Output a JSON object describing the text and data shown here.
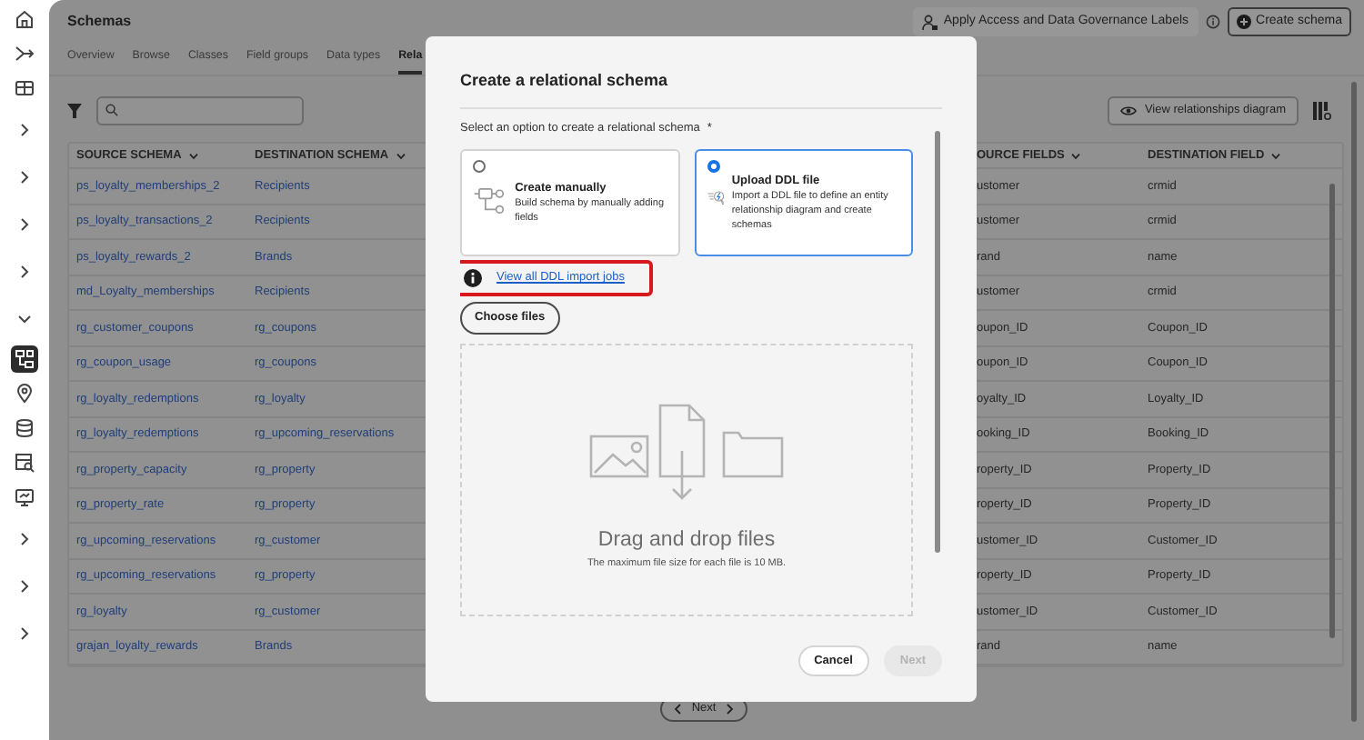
{
  "rail": [
    {
      "kind": "home",
      "selected": false
    },
    {
      "kind": "connect",
      "selected": false
    },
    {
      "kind": "panel",
      "selected": false
    },
    {
      "kind": "expand",
      "selected": false
    },
    {
      "kind": "expand",
      "selected": false
    },
    {
      "kind": "expand",
      "selected": false
    },
    {
      "kind": "expand",
      "selected": false
    },
    {
      "kind": "collapse",
      "selected": false
    },
    {
      "kind": "schema",
      "selected": true
    },
    {
      "kind": "pin",
      "selected": false
    },
    {
      "kind": "database",
      "selected": false
    },
    {
      "kind": "query",
      "selected": false
    },
    {
      "kind": "monitor",
      "selected": false
    },
    {
      "kind": "expand",
      "selected": false
    },
    {
      "kind": "expand",
      "selected": false
    },
    {
      "kind": "expand",
      "selected": false
    }
  ],
  "page": {
    "title": "Schemas",
    "labels_button": "Apply Access and Data Governance Labels",
    "create_button": "Create schema"
  },
  "tabs": [
    {
      "label": "Overview",
      "selected": false
    },
    {
      "label": "Browse",
      "selected": false
    },
    {
      "label": "Classes",
      "selected": false
    },
    {
      "label": "Field groups",
      "selected": false
    },
    {
      "label": "Data types",
      "selected": false
    },
    {
      "label": "Rela",
      "selected": true
    }
  ],
  "toolbar": {
    "diagram_button": "View relationships diagram"
  },
  "table": {
    "columns": [
      "SOURCE SCHEMA",
      "DESTINATION SCHEMA",
      "OURCE FIELDS",
      "DESTINATION FIELD"
    ],
    "rows": [
      [
        "ps_loyalty_memberships_2",
        "Recipients",
        "ustomer",
        "crmid"
      ],
      [
        "ps_loyalty_transactions_2",
        "Recipients",
        "ustomer",
        "crmid"
      ],
      [
        "ps_loyalty_rewards_2",
        "Brands",
        "rand",
        "name"
      ],
      [
        "md_Loyalty_memberships",
        "Recipients",
        "ustomer",
        "crmid"
      ],
      [
        "rg_customer_coupons",
        "rg_coupons",
        "oupon_ID",
        "Coupon_ID"
      ],
      [
        "rg_coupon_usage",
        "rg_coupons",
        "oupon_ID",
        "Coupon_ID"
      ],
      [
        "rg_loyalty_redemptions",
        "rg_loyalty",
        "oyalty_ID",
        "Loyalty_ID"
      ],
      [
        "rg_loyalty_redemptions",
        "rg_upcoming_reservations",
        "ooking_ID",
        "Booking_ID"
      ],
      [
        "rg_property_capacity",
        "rg_property",
        "roperty_ID",
        "Property_ID"
      ],
      [
        "rg_property_rate",
        "rg_property",
        "roperty_ID",
        "Property_ID"
      ],
      [
        "rg_upcoming_reservations",
        "rg_customer",
        "ustomer_ID",
        "Customer_ID"
      ],
      [
        "rg_upcoming_reservations",
        "rg_property",
        "roperty_ID",
        "Property_ID"
      ],
      [
        "rg_loyalty",
        "rg_customer",
        "ustomer_ID",
        "Customer_ID"
      ],
      [
        "grajan_loyalty_rewards",
        "Brands",
        "rand",
        "name"
      ]
    ]
  },
  "pagination": {
    "next": "Next"
  },
  "dialog": {
    "title": "Create a relational schema",
    "prompt": "Select an option to create a relational schema",
    "required_mark": "*",
    "options": [
      {
        "kind": "manual",
        "title": "Create manually",
        "description": "Build schema by manually adding fields",
        "selected": false
      },
      {
        "kind": "upload",
        "title": "Upload DDL file",
        "description": "Import a DDL file to define an entity relationship diagram and create schemas",
        "selected": true
      }
    ],
    "jobs_link": {
      "label": "View all DDL import jobs",
      "highlighted": true
    },
    "choose_button": "Choose files",
    "dropzone": {
      "title": "Drag and drop files",
      "note": "The maximum file size for each file is 10 MB."
    },
    "buttons": [
      {
        "label": "Cancel",
        "disabled": false
      },
      {
        "label": "Next",
        "disabled": true
      }
    ]
  }
}
